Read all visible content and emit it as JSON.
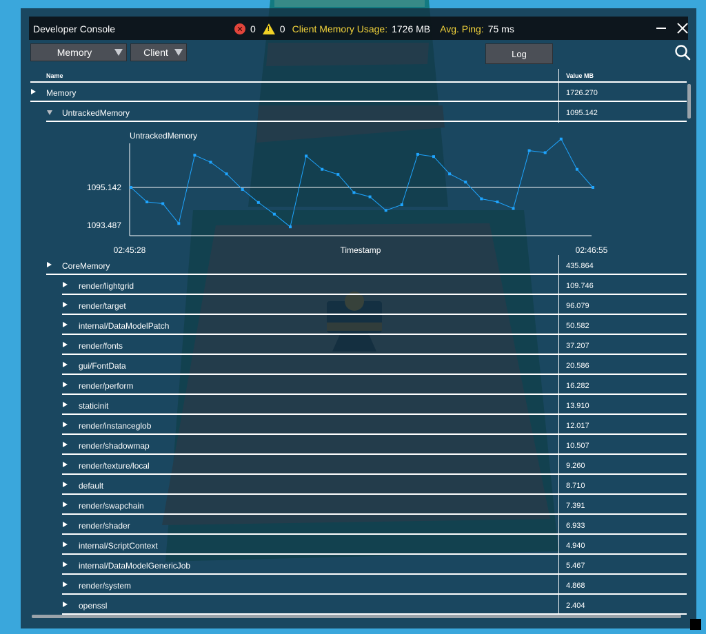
{
  "window": {
    "title": "Developer Console"
  },
  "status": {
    "error_count": "0",
    "warning_count": "0",
    "memory_label": "Client Memory Usage:",
    "memory_value": "1726 MB",
    "ping_label": "Avg. Ping:",
    "ping_value": "75 ms"
  },
  "toolbar": {
    "view_dropdown": "Memory",
    "target_dropdown": "Client",
    "log_button": "Log"
  },
  "table": {
    "headers": {
      "name": "Name",
      "value": "Value MB"
    },
    "top_rows": [
      {
        "name": "Memory",
        "value": "1726.270"
      },
      {
        "name": "UntrackedMemory",
        "value": "1095.142"
      }
    ],
    "core": {
      "name": "CoreMemory",
      "value": "435.864"
    },
    "items": [
      {
        "name": "render/lightgrid",
        "value": "109.746"
      },
      {
        "name": "render/target",
        "value": "96.079"
      },
      {
        "name": "internal/DataModelPatch",
        "value": "50.582"
      },
      {
        "name": "render/fonts",
        "value": "37.207"
      },
      {
        "name": "gui/FontData",
        "value": "20.586"
      },
      {
        "name": "render/perform",
        "value": "16.282"
      },
      {
        "name": "staticinit",
        "value": "13.910"
      },
      {
        "name": "render/instanceglob",
        "value": "12.017"
      },
      {
        "name": "render/shadowmap",
        "value": "10.507"
      },
      {
        "name": "render/texture/local",
        "value": "9.260"
      },
      {
        "name": "default",
        "value": "8.710"
      },
      {
        "name": "render/swapchain",
        "value": "7.391"
      },
      {
        "name": "render/shader",
        "value": "6.933"
      },
      {
        "name": "internal/ScriptContext",
        "value": "4.940"
      },
      {
        "name": "internal/DataModelGenericJob",
        "value": "5.467"
      },
      {
        "name": "render/system",
        "value": "4.868"
      },
      {
        "name": "openssl",
        "value": "2.404"
      }
    ]
  },
  "chart_data": {
    "type": "line",
    "title": "UntrackedMemory",
    "xlabel": "Timestamp",
    "x_start_label": "02:45:28",
    "x_end_label": "02:46:55",
    "y_ref_label": "1095.142",
    "y_min_label": "1093.487",
    "y_ref": 1095.142,
    "ylim": [
      1093.487,
      1096.6
    ],
    "series": [
      {
        "values": [
          1095.14,
          1094.63,
          1094.57,
          1093.87,
          1096.28,
          1096.03,
          1095.62,
          1095.07,
          1094.61,
          1094.2,
          1093.75,
          1096.25,
          1095.78,
          1095.6,
          1094.96,
          1094.81,
          1094.33,
          1094.53,
          1096.31,
          1096.23,
          1095.62,
          1095.33,
          1094.74,
          1094.63,
          1094.4,
          1096.44,
          1096.37,
          1096.85,
          1095.78,
          1095.14
        ]
      }
    ],
    "color": "#1ea5ff"
  }
}
